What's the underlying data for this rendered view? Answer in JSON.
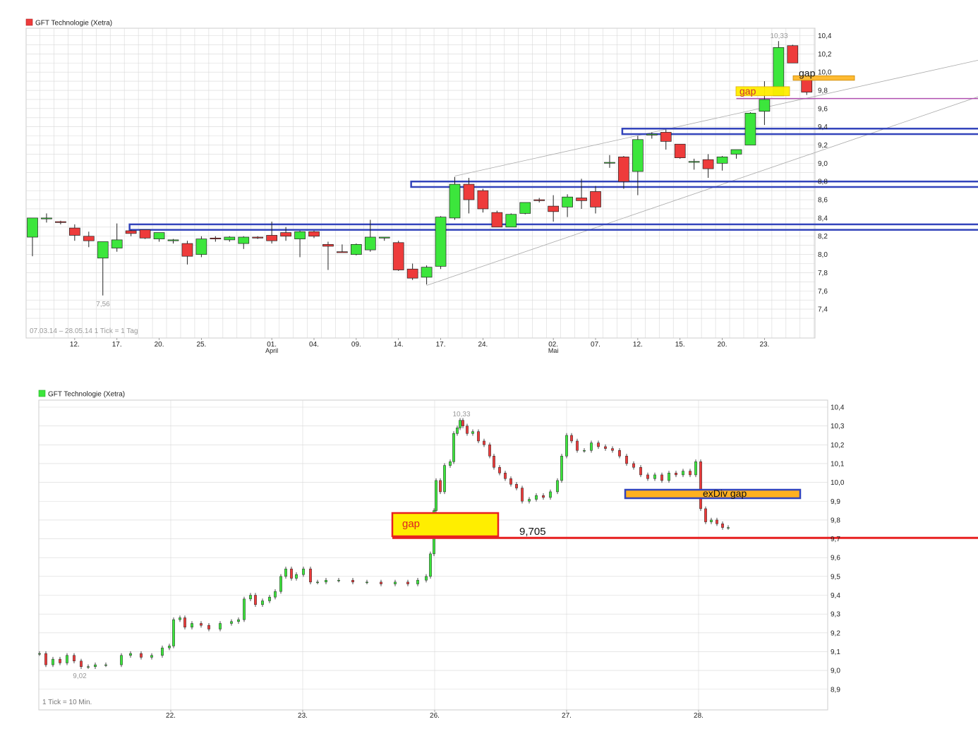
{
  "colors": {
    "up": "#3ce63c",
    "down": "#ee3b3b",
    "zone": "#3344bb",
    "gap_fill": "#ffd700",
    "gap_fill2": "#ffee00",
    "red_line": "#e82020",
    "magenta": "#b050b0",
    "grid": "#d8d8d8"
  },
  "chart1": {
    "legend": "GFT Technologie (Xetra)",
    "info": "07.03.14 – 28.05.14   1 Tick = 1 Tag",
    "ymin": 7.2,
    "ymax": 10.5,
    "yticks": [
      "10,4",
      "10,2",
      "10,0",
      "9,8",
      "9,6",
      "9,4",
      "9,2",
      "9,0",
      "8,8",
      "8,6",
      "8,4",
      "8,2",
      "8,0",
      "7,8",
      "7,6",
      "7,4"
    ],
    "xlabels": [
      {
        "i": 3,
        "t": "12."
      },
      {
        "i": 6,
        "t": "17."
      },
      {
        "i": 9,
        "t": "20."
      },
      {
        "i": 12,
        "t": "25."
      },
      {
        "i": 17,
        "t": "01.",
        "sub": "April"
      },
      {
        "i": 20,
        "t": "04."
      },
      {
        "i": 23,
        "t": "09."
      },
      {
        "i": 26,
        "t": "14."
      },
      {
        "i": 29,
        "t": "17."
      },
      {
        "i": 32,
        "t": "24."
      },
      {
        "i": 37,
        "t": "02.",
        "sub": "Mai"
      },
      {
        "i": 40,
        "t": "07."
      },
      {
        "i": 43,
        "t": "12."
      },
      {
        "i": 46,
        "t": "15."
      },
      {
        "i": 49,
        "t": "20."
      },
      {
        "i": 52,
        "t": "23."
      }
    ],
    "high_label": "10,33",
    "low_label": "7,56",
    "gap_label": "gap",
    "gap_label2": "gap"
  },
  "chart1_data": {
    "type": "candlestick",
    "ohlc": [
      [
        8.19,
        8.34,
        7.98,
        8.4
      ],
      [
        8.39,
        8.45,
        8.35,
        8.4
      ],
      [
        8.36,
        8.37,
        8.33,
        8.35
      ],
      [
        8.29,
        8.33,
        8.15,
        8.21
      ],
      [
        8.2,
        8.25,
        8.08,
        8.15
      ],
      [
        7.96,
        8.08,
        7.55,
        8.14
      ],
      [
        8.07,
        8.34,
        8.03,
        8.16
      ],
      [
        8.26,
        8.27,
        8.2,
        8.23
      ],
      [
        8.27,
        8.27,
        8.17,
        8.18
      ],
      [
        8.17,
        8.22,
        8.14,
        8.24
      ],
      [
        8.15,
        8.17,
        8.12,
        8.16
      ],
      [
        8.12,
        8.15,
        7.89,
        7.98
      ],
      [
        8.0,
        8.2,
        7.97,
        8.17
      ],
      [
        8.18,
        8.2,
        8.14,
        8.17
      ],
      [
        8.16,
        8.2,
        8.14,
        8.19
      ],
      [
        8.12,
        8.2,
        8.06,
        8.19
      ],
      [
        8.19,
        8.2,
        8.17,
        8.18
      ],
      [
        8.21,
        8.36,
        8.12,
        8.15
      ],
      [
        8.24,
        8.3,
        8.15,
        8.2
      ],
      [
        8.17,
        8.26,
        7.97,
        8.25
      ],
      [
        8.25,
        8.26,
        8.18,
        8.2
      ],
      [
        8.11,
        8.14,
        7.83,
        8.09
      ],
      [
        8.03,
        8.11,
        8.03,
        8.02
      ],
      [
        8.0,
        8.12,
        7.99,
        8.11
      ],
      [
        8.05,
        8.38,
        8.03,
        8.19
      ],
      [
        8.18,
        8.19,
        8.15,
        8.19
      ],
      [
        8.13,
        8.15,
        7.82,
        7.83
      ],
      [
        7.84,
        7.9,
        7.72,
        7.74
      ],
      [
        7.75,
        7.88,
        7.67,
        7.86
      ],
      [
        7.87,
        8.42,
        7.84,
        8.41
      ],
      [
        8.4,
        8.85,
        8.38,
        8.77
      ],
      [
        8.77,
        8.84,
        8.45,
        8.6
      ],
      [
        8.7,
        8.72,
        8.46,
        8.5
      ],
      [
        8.46,
        8.48,
        8.3,
        8.3
      ],
      [
        8.3,
        8.45,
        8.3,
        8.44
      ],
      [
        8.45,
        8.57,
        8.44,
        8.57
      ],
      [
        8.6,
        8.62,
        8.57,
        8.59
      ],
      [
        8.53,
        8.65,
        8.36,
        8.47
      ],
      [
        8.52,
        8.66,
        8.41,
        8.63
      ],
      [
        8.62,
        8.83,
        8.5,
        8.59
      ],
      [
        8.69,
        8.75,
        8.45,
        8.52
      ],
      [
        9.01,
        9.09,
        8.95,
        9.01
      ],
      [
        9.07,
        9.08,
        8.72,
        8.8
      ],
      [
        8.91,
        9.3,
        8.65,
        9.26
      ],
      [
        9.31,
        9.34,
        9.27,
        9.32
      ],
      [
        9.34,
        9.37,
        9.15,
        9.24
      ],
      [
        9.21,
        9.21,
        9.05,
        9.06
      ],
      [
        9.02,
        9.05,
        8.93,
        9.02
      ],
      [
        9.04,
        9.1,
        8.84,
        8.94
      ],
      [
        9.0,
        9.08,
        8.92,
        9.07
      ],
      [
        9.1,
        9.13,
        9.05,
        9.15
      ],
      [
        9.2,
        9.56,
        9.2,
        9.55
      ],
      [
        9.57,
        9.9,
        9.42,
        9.7
      ],
      [
        9.74,
        10.34,
        9.74,
        10.27
      ],
      [
        10.29,
        10.3,
        10.1,
        10.1
      ],
      [
        9.93,
        9.93,
        9.75,
        9.78
      ]
    ]
  },
  "chart2": {
    "legend": "GFT Technologie (Xetra)",
    "info": "1 Tick = 10 Min.",
    "ymin": 8.81,
    "ymax": 10.45,
    "yticks": [
      "10,4",
      "10,3",
      "10,2",
      "10,1",
      "10,0",
      "9,9",
      "9,8",
      "9,7",
      "9,6",
      "9,5",
      "9,4",
      "9,3",
      "9,2",
      "9,1",
      "9,0",
      "8,9"
    ],
    "xlabels": [
      "22.",
      "23.",
      "26.",
      "27.",
      "28."
    ],
    "high_label": "10,33",
    "low_label": "9,02",
    "gap_label": "gap",
    "level_label": "9,705",
    "exdiv_label": "exDiv gap"
  }
}
